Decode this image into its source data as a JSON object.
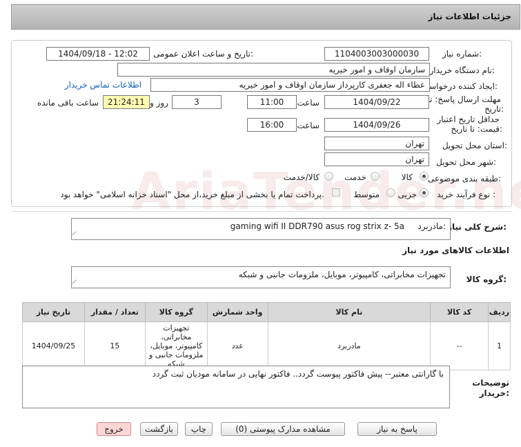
{
  "header": {
    "title": "جزئیات اطلاعات نیاز"
  },
  "fields": {
    "need_number_label": "شماره نیاز:",
    "need_number": "1104003003000030",
    "announce_label": "تاریخ و ساعت اعلان عمومی:",
    "announce_value": "1404/09/18 - 12:02",
    "buyer_org_label": "نام دستگاه خریدار:",
    "buyer_org": "سازمان اوقاف و امور خیریه",
    "requester_label": "ایجاد کننده درخواست:",
    "requester": "عطاء اله جعفری کارپرداز سازمان اوقاف و امور خیریه",
    "contact_link": "اطلاعات تماس خریدار",
    "deadline_label_1": "مهلت ارسال پاسخ: تا",
    "deadline_label_2": "تاریخ:",
    "deadline_date": "1404/09/22",
    "time_label": "ساعت",
    "deadline_time": "11:00",
    "days_value": "3",
    "days_label": "روز و",
    "remaining_time": "21:24:11",
    "remaining_label": "ساعت باقی مانده",
    "validity_label_1": "حداقل تاریخ اعتبار",
    "validity_label_2": "قیمت: تا تاریخ:",
    "validity_date": "1404/09/26",
    "validity_time": "16:00",
    "province_label": "استان محل تحویل:",
    "province": "تهران",
    "city_label": "شهر محل تحویل:",
    "city": "تهران",
    "category_label": "طبقه بندی موضوعی:",
    "category_options": [
      "کالا",
      "خدمت",
      "کالا/خدمت"
    ],
    "process_label": "نوع فرآیند خرید :",
    "process_options": [
      "جزیی",
      "متوسط"
    ],
    "payment_note": "پرداخت تمام یا بخشی از مبلغ خرید،از محل \"اسناد خزانه اسلامی\" خواهد بود."
  },
  "summary": {
    "label": "شرح کلی نیاز:",
    "prefix": "مادربرد:",
    "text": "gaming wifi II DDR790 asus rog strix z- 5a"
  },
  "goods_info_title": "اطلاعات کالاهای مورد نیاز",
  "goods_group": {
    "label": "گروه کالا:",
    "value": "تجهیزات مخابراتی، کامپیوتر، موبایل، ملزومات جانبی و شبکه"
  },
  "table": {
    "headers": [
      "ردیف",
      "کد کالا",
      "نام کالا",
      "واحد شمارش",
      "گروه کالا",
      "تعداد / مقدار",
      "تاریخ نیاز"
    ],
    "rows": [
      [
        "1",
        "--",
        "مادربرد",
        "عدد",
        "تجهیزات مخابراتی، کامپیوتر، موبایل، ملزومات جانبی و شبکه",
        "15",
        "1404/09/25"
      ]
    ]
  },
  "buyer_notes": {
    "label_1": "توضیحات",
    "label_2": "خریدار:",
    "text": "با گارانتی معتبر-- پیش فاکتور پیوست گردد.. فاکتور نهایی در سامانه مودیان ثبت گردد"
  },
  "buttons": {
    "reply": "پاسخ به نیاز",
    "view_docs": "مشاهده مدارک پیوستی (0)",
    "print": "چاپ",
    "back": "بازگشت",
    "exit": "خروج"
  },
  "watermark": "AriaTender.neT"
}
